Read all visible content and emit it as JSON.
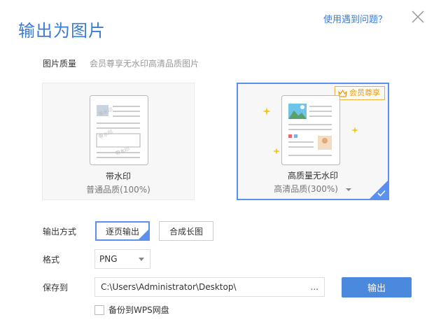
{
  "dialog": {
    "title": "输出为图片",
    "help_link": "使用遇到问题？"
  },
  "quality": {
    "label": "图片质量",
    "description": "会员尊享无水印高清品质图片",
    "options": [
      {
        "name": "带水印",
        "sub": "普通品质(100%)",
        "watermark_text": [
          "带水印",
          "带水印",
          "带水印"
        ]
      },
      {
        "name": "高质量无水印",
        "sub": "高清品质(300%)",
        "badge": "会员尊享",
        "selected": true
      }
    ]
  },
  "output_mode": {
    "label": "输出方式",
    "options": [
      "逐页输出",
      "合成长图"
    ],
    "selected": "逐页输出"
  },
  "format": {
    "label": "格式",
    "value": "PNG"
  },
  "save_to": {
    "label": "保存到",
    "path": "C:\\Users\\Administrator\\Desktop\\",
    "browse": "..."
  },
  "export_button": "输出",
  "backup": {
    "label": "备份到WPS网盘",
    "checked": false
  },
  "colors": {
    "accent": "#4b89dc",
    "title": "#3a7bd5",
    "vip": "#e79b1a"
  }
}
